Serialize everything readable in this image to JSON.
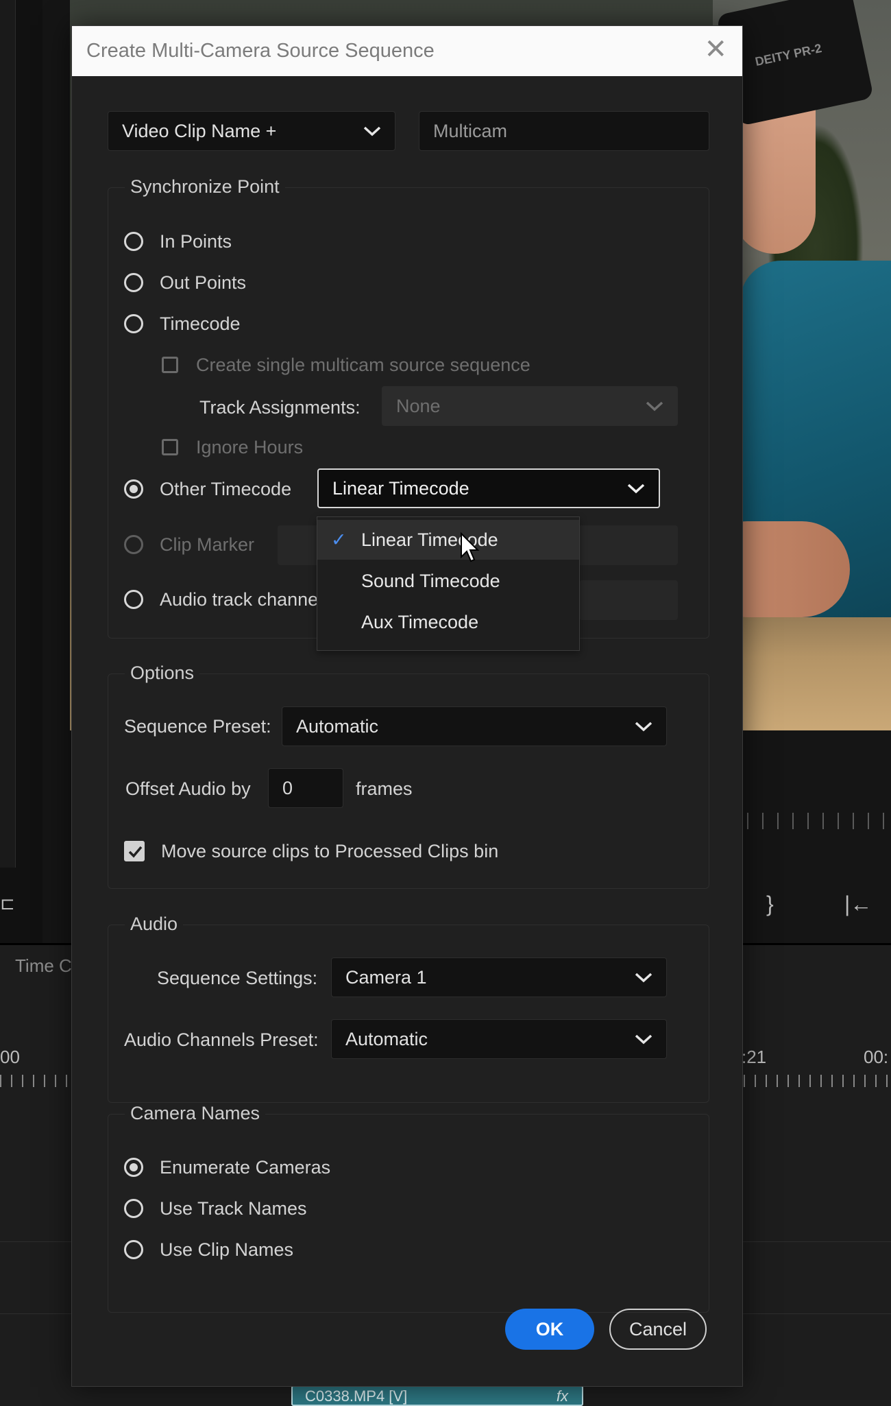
{
  "dialog": {
    "title": "Create Multi-Camera Source Sequence",
    "name_mode": "Video Clip Name +",
    "name_value": "Multicam"
  },
  "sync": {
    "group_label": "Synchronize Point",
    "in_points": "In Points",
    "out_points": "Out Points",
    "timecode": "Timecode",
    "create_single": "Create single multicam source sequence",
    "track_assignments_label": "Track Assignments:",
    "track_assignments_value": "None",
    "ignore_hours": "Ignore Hours",
    "other_timecode": "Other Timecode",
    "other_timecode_value": "Linear Timecode",
    "clip_marker": "Clip Marker",
    "audio_track_channel": "Audio track channe",
    "selected": "other_timecode"
  },
  "timecode_menu": {
    "items": [
      {
        "label": "Linear Timecode",
        "checked": true
      },
      {
        "label": "Sound Timecode",
        "checked": false
      },
      {
        "label": "Aux Timecode",
        "checked": false
      }
    ],
    "check_glyph": "✓"
  },
  "options": {
    "group_label": "Options",
    "sequence_preset_label": "Sequence Preset:",
    "sequence_preset_value": "Automatic",
    "offset_audio_label": "Offset Audio by",
    "offset_audio_value": "0",
    "frames_label": "frames",
    "move_clips_label": "Move source clips to Processed Clips bin",
    "move_clips_checked": true
  },
  "audio": {
    "group_label": "Audio",
    "sequence_settings_label": "Sequence Settings:",
    "sequence_settings_value": "Camera 1",
    "channels_preset_label": "Audio Channels Preset:",
    "channels_preset_value": "Automatic"
  },
  "camera_names": {
    "group_label": "Camera Names",
    "enumerate": "Enumerate Cameras",
    "track_names": "Use Track Names",
    "clip_names": "Use Clip Names",
    "selected": "enumerate"
  },
  "buttons": {
    "ok": "OK",
    "cancel": "Cancel"
  },
  "background": {
    "device_label": "DEITY PR-2",
    "timeline_label": "Time C",
    "time_left": "00",
    "time_right_1": ":21",
    "time_right_2": "00:",
    "clip_name": "C0338.MP4 [V]",
    "clip_fx": "fx"
  },
  "colors": {
    "accent": "#1973e6",
    "check": "#4b8ef0",
    "dialog_bg": "#202020"
  }
}
